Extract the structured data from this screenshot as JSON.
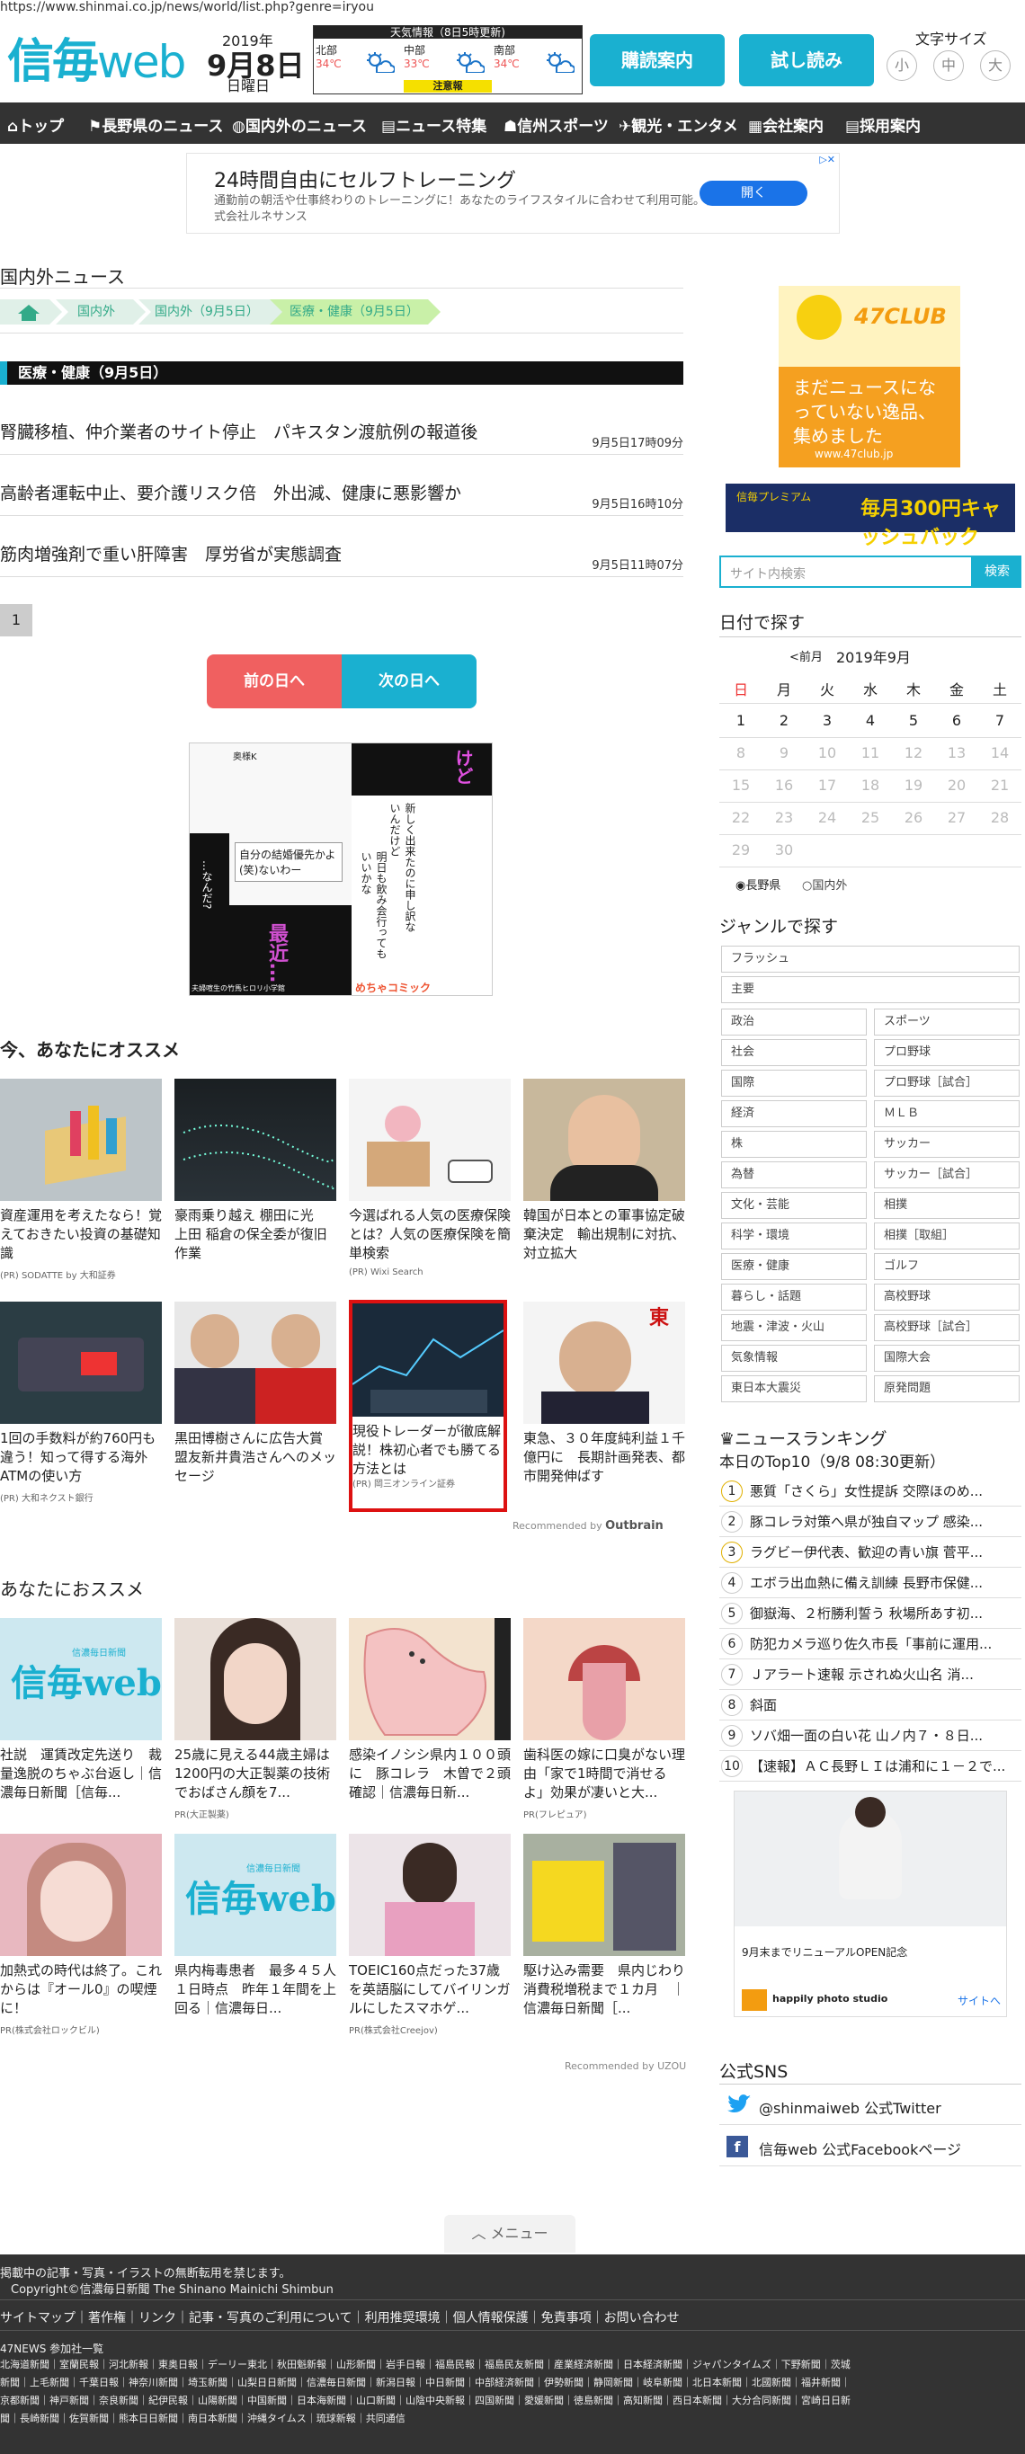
{
  "url": "https://www.shinmai.co.jp/news/world/list.php?genre=iryou",
  "header": {
    "logo_main": "信毎",
    "logo_web": "web",
    "year": "2019年",
    "date": "9月8日",
    "dow": "日曜日",
    "weather_title": "天気情報（8日5時更新)",
    "weather": [
      {
        "region": "北部",
        "temp": "34℃"
      },
      {
        "region": "中部",
        "temp": "33℃"
      },
      {
        "region": "南部",
        "temp": "34℃"
      }
    ],
    "weather_warning": "注意報",
    "btn_subscribe": "購読案内",
    "btn_trial": "試し読み",
    "font_size_label": "文字サイズ",
    "font_sizes": [
      "小",
      "中",
      "大"
    ]
  },
  "nav": [
    "トップ",
    "長野県のニュース",
    "国内外のニュース",
    "ニュース特集",
    "信州スポーツ",
    "観光・エンタメ",
    "会社案内",
    "採用案内"
  ],
  "top_ad": {
    "headline": "24時間自由にセルフトレーニング",
    "body": "通勤前の朝活や仕事終わりのトレーニングに！あなたのライフスタイルに合わせて利用可能。株式会社ルネサンス",
    "button": "開く"
  },
  "section_title": "国内外ニュース",
  "breadcrumbs": [
    "国内外",
    "国内外（9月5日）",
    "医療・健康（9月5日）"
  ],
  "category_header": "医療・健康（9月5日）",
  "news": [
    {
      "title": "腎臓移植、仲介業者のサイト停止　パキスタン渡航例の報道後",
      "date": "9月5日17時09分"
    },
    {
      "title": "高齢者運転中止、要介護リスク倍　外出減、健康に悪影響か",
      "date": "9月5日16時10分"
    },
    {
      "title": "筋肉増強剤で重い肝障害　厚労省が実態調査",
      "date": "9月5日11時07分"
    }
  ],
  "page_number": "1",
  "prev_day": "前の日へ",
  "next_day": "次の日へ",
  "manga": {
    "name_top": "奥様K",
    "text1": "自分の結婚優先かよ(笑)ないわー",
    "text2": "…なんだ?",
    "text3": "最近…",
    "keto": "けど",
    "bubble1": "新しく出来たのに申し訳ないんだけど",
    "bubble2": "明日も飲み会行ってもいいかな",
    "caption": "夫婦喧生の竹馬ヒロリ小学館",
    "brand": "めちゃコミック"
  },
  "recommend_title": "今、あなたにオススメ",
  "recommend": [
    {
      "caption": "資産運用を考えたなら！覚えておきたい投資の基礎知識",
      "pr": "(PR) SODATTE by 大和証券"
    },
    {
      "caption": "豪雨乗り越え 棚田に光　上田 稲倉の保全委が復旧作業",
      "pr": ""
    },
    {
      "caption": "今選ばれる人気の医療保険とは？人気の医療保険を簡単検索",
      "pr": "(PR) Wixi Search"
    },
    {
      "caption": "韓国が日本との軍事協定破棄決定　輸出規制に対抗、対立拡大",
      "pr": ""
    },
    {
      "caption": "1回の手数料が約760円も違う！知って得する海外ATMの使い方",
      "pr": "(PR) 大和ネクスト銀行"
    },
    {
      "caption": "黒田博樹さんに広告大賞　盟友新井貴浩さんへのメッセージ",
      "pr": ""
    },
    {
      "caption": "現役トレーダーが徹底解説！株初心者でも勝てる方法とは",
      "pr": "(PR) 岡三オンライン証券"
    },
    {
      "caption": "東急、３０年度純利益１千億円に　長期計画発表、都市開発伸ばす",
      "pr": ""
    }
  ],
  "recommended_by": "Recommended by",
  "outbrain": "Outbrain",
  "recommend2_title": "あなたにおススメ",
  "recommend2": [
    {
      "caption": "社説　運賃改定先送り　裁量逸脱のちゃぶ台返し｜信濃毎日新聞［信毎...",
      "pr": ""
    },
    {
      "caption": "25歳に見える44歳主婦は1200円の大正製薬の技術でおばさん顔を7...",
      "pr": "PR(大正製薬)"
    },
    {
      "caption": "感染イノシシ県内１００頭に　豚コレラ　木曽で２頭確認｜信濃毎日新...",
      "pr": ""
    },
    {
      "caption": "歯科医の嫁に口臭がない理由「家で1時間で消せるよ」効果が凄いと大...",
      "pr": "PR(フレピュア)"
    },
    {
      "caption": "加熱式の時代は終了。これからは『オール0』の喫煙に！",
      "pr": "PR(株式会社ロックビル)"
    },
    {
      "caption": "県内梅毒患者　最多４５人　１日時点　昨年１年間を上回る｜信濃毎日...",
      "pr": ""
    },
    {
      "caption": "TOEIC160点だった37歳を英語脳にしてバイリンガルにしたスマホゲ...",
      "pr": "PR(株式会社Creejov)"
    },
    {
      "caption": "駆け込み需要　県内じわり　消費税増税まで１カ月　｜信濃毎日新聞［...",
      "pr": ""
    }
  ],
  "uzou": "Recommended by UZOU",
  "web_logo": "信毎web",
  "web_logo_sub": "信濃毎日新聞",
  "sidebar": {
    "club_ad_text": "まだニュースになっていない逸品、集めました",
    "club_url": "www.47club.jp",
    "club_brand": "47CLUB",
    "premium_ad": "毎月300円キャッシュバック",
    "premium_label": "信毎プレミアム",
    "search_placeholder": "サイト内検索",
    "search_button": "検索",
    "date_title": "日付で探す",
    "prev_month": "<前月",
    "month": "2019年9月",
    "weekdays": [
      "日",
      "月",
      "火",
      "水",
      "木",
      "金",
      "土"
    ],
    "weeks": [
      [
        "1",
        "2",
        "3",
        "4",
        "5",
        "6",
        "7"
      ],
      [
        "8",
        "9",
        "10",
        "11",
        "12",
        "13",
        "14"
      ],
      [
        "15",
        "16",
        "17",
        "18",
        "19",
        "20",
        "21"
      ],
      [
        "22",
        "23",
        "24",
        "25",
        "26",
        "27",
        "28"
      ],
      [
        "29",
        "30",
        "",
        "",
        "",
        "",
        ""
      ]
    ],
    "radio_nagano": "長野県",
    "radio_domestic": "国内外",
    "genre_title": "ジャンルで探す",
    "genres_full": [
      "フラッシュ",
      "主要"
    ],
    "genres": [
      [
        "政治",
        "スポーツ"
      ],
      [
        "社会",
        "プロ野球"
      ],
      [
        "国際",
        "プロ野球［試合］"
      ],
      [
        "経済",
        "ＭＬＢ"
      ],
      [
        "株",
        "サッカー"
      ],
      [
        "為替",
        "サッカー［試合］"
      ],
      [
        "文化・芸能",
        "相撲"
      ],
      [
        "科学・環境",
        "相撲［取組］"
      ],
      [
        "医療・健康",
        "ゴルフ"
      ],
      [
        "暮らし・話題",
        "高校野球"
      ],
      [
        "地震・津波・火山",
        "高校野球［試合］"
      ],
      [
        "気象情報",
        "国際大会"
      ],
      [
        "東日本大震災",
        "原発問題"
      ]
    ],
    "ranking_title": "ニュースランキング",
    "ranking_sub": "本日のTop10（9/8 08:30更新）",
    "ranking": [
      "悪質「さくら」女性提訴 交際ほのめ...",
      "豚コレラ対策へ県が独自マップ 感染...",
      "ラグビー伊代表、歓迎の青い旗 菅平...",
      "エボラ出血熱に備え訓練 長野市保健...",
      "御嶽海、２桁勝利誓う 秋場所あす初...",
      "防犯カメラ巡り佐久市長「事前に運用...",
      "Ｊアラート速報 示されぬ火山名 消...",
      "斜面",
      "ソバ畑一面の白い花 山ノ内７・８日...",
      "【速報】ＡＣ長野ＬＩは浦和に１－２で..."
    ],
    "side_ad_caption": "9月末までリニューアルOPEN記念",
    "side_ad_brand": "happily photo studio",
    "side_ad_link": "サイトへ",
    "sns_title": "公式SNS",
    "twitter": "@shinmaiweb 公式Twitter",
    "facebook": "信毎web 公式Facebookページ"
  },
  "menu": "メニュー",
  "footer": {
    "notice": "掲載中の記事・写真・イラストの無断転用を禁じます。",
    "copyright": "Copyright©信濃毎日新聞 The Shinano Mainichi Shimbun",
    "links": "サイトマップ｜著作権｜リンク｜記事・写真のご利用について｜利用推奨環境｜個人情報保護｜免責事項｜お問い合わせ",
    "member_title": "47NEWS 参加社一覧",
    "members1": "北海道新聞｜室蘭民報｜河北新報｜東奥日報｜デーリー東北｜秋田魁新報｜山形新聞｜岩手日報｜福島民報｜福島民友新聞｜産業経済新聞｜日本経済新聞｜ジャパンタイムズ｜下野新聞｜茨城",
    "members2": "新聞｜上毛新聞｜千葉日報｜神奈川新聞｜埼玉新聞｜山梨日日新聞｜信濃毎日新聞｜新潟日報｜中日新聞｜中部経済新聞｜伊勢新聞｜静岡新聞｜岐阜新聞｜北日本新聞｜北國新聞｜福井新聞｜",
    "members3": "京都新聞｜神戸新聞｜奈良新聞｜紀伊民報｜山陽新聞｜中国新聞｜日本海新聞｜山口新聞｜山陰中央新報｜四国新聞｜愛媛新聞｜徳島新聞｜高知新聞｜西日本新聞｜大分合同新聞｜宮崎日日新",
    "members4": "聞｜長崎新聞｜佐賀新聞｜熊本日日新聞｜南日本新聞｜沖縄タイムス｜琉球新報｜共同通信"
  }
}
